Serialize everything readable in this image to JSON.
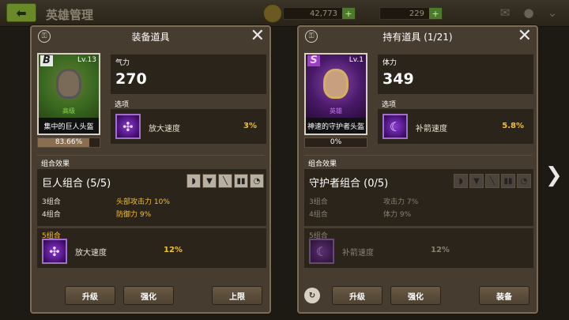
{
  "topbar": {
    "title": "英雄管理",
    "currency1": "42,773",
    "currency2": "229",
    "plus": "+"
  },
  "left": {
    "title": "装备道具",
    "card": {
      "grade": "B",
      "level": "Lv.13",
      "rarity": "高级",
      "name": "集中的巨人头盔",
      "progress_text": "83.66%",
      "progress": 0.8366
    },
    "stat_label": "气力",
    "stat_value": "270",
    "option_label": "选项",
    "option_name": "放大速度",
    "option_value": "3%",
    "combo_label": "组合效果",
    "set_name": "巨人组合 (5/5)",
    "tiers": [
      {
        "tier": "3组合",
        "effect": "头部攻击力 10%"
      },
      {
        "tier": "4组合",
        "effect": "防御力 9%"
      }
    ],
    "bonus_label": "5组合",
    "bonus_name": "放大速度",
    "bonus_value": "12%",
    "buttons": [
      "升级",
      "强化",
      "上限"
    ]
  },
  "right": {
    "title": "持有道具 (1/21)",
    "card": {
      "grade": "S",
      "level": "Lv.1",
      "rarity": "英雄",
      "name": "神速的守护者头盔",
      "progress_text": "0%",
      "progress": 0
    },
    "stat_label": "体力",
    "stat_value": "349",
    "option_label": "选项",
    "option_name": "补箭速度",
    "option_value": "5.8%",
    "combo_label": "组合效果",
    "set_name": "守护者组合 (0/5)",
    "tiers": [
      {
        "tier": "3组合",
        "effect": "攻击力 7%"
      },
      {
        "tier": "4组合",
        "effect": "体力 9%"
      }
    ],
    "bonus_label": "5组合",
    "bonus_name": "补箭速度",
    "bonus_value": "12%",
    "buttons": [
      "升级",
      "强化",
      "装备"
    ]
  },
  "icons": {
    "back": "arrow-left-icon",
    "lock": "lock-icon",
    "close": "close-icon",
    "mail": "mail-icon",
    "chat": "chat-icon",
    "collapse": "chevron-down-icon",
    "next": "chevron-right-icon",
    "refresh": "refresh-icon"
  }
}
